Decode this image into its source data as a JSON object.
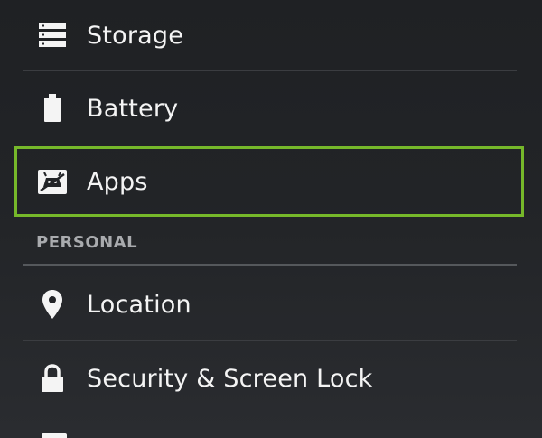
{
  "settings": {
    "items": [
      {
        "label": "Storage",
        "icon": "storage-icon"
      },
      {
        "label": "Battery",
        "icon": "battery-icon"
      },
      {
        "label": "Apps",
        "icon": "apps-icon"
      }
    ],
    "personal_header": "PERSONAL",
    "personal_items": [
      {
        "label": "Location",
        "icon": "location-pin-icon"
      },
      {
        "label": "Security & Screen Lock",
        "icon": "lock-icon"
      }
    ]
  },
  "colors": {
    "background": "#222427",
    "highlight": "#76b82a",
    "divider": "#3b3d41",
    "section_header": "#a9abae"
  }
}
